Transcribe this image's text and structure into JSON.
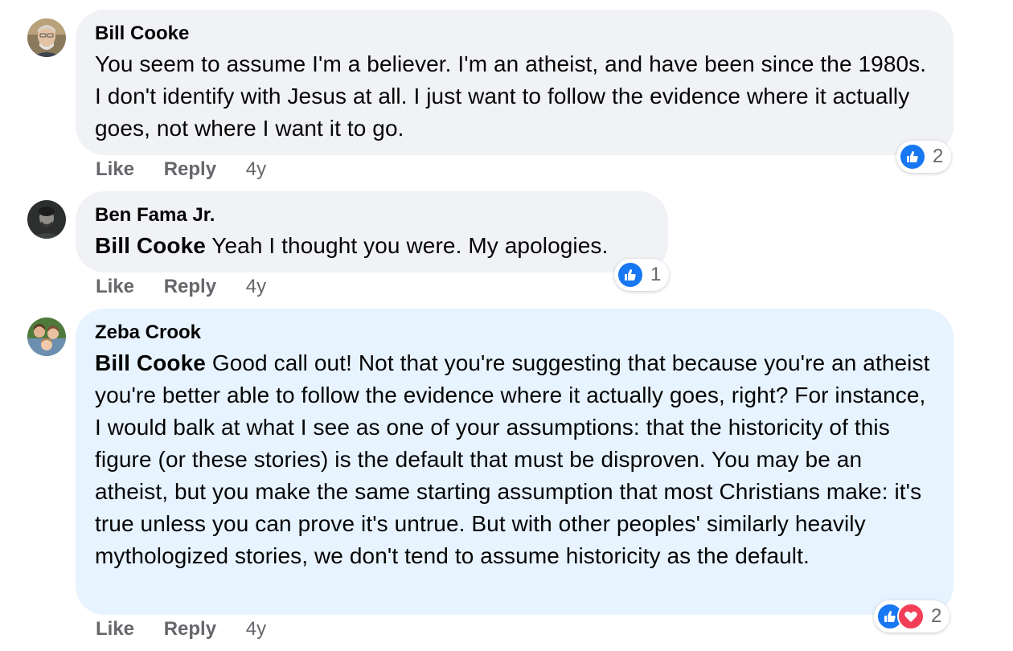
{
  "colors": {
    "bubble_gray": "#f0f2f5",
    "bubble_highlight": "#e7f3ff",
    "meta_text": "#65676b",
    "like_blue": "#1877f2",
    "love_red": "#f33e58"
  },
  "comments": [
    {
      "author": "Bill Cooke",
      "mention": "",
      "text": "You seem to assume I'm a believer. I'm an atheist, and have been since the 1980s. I don't identify with Jesus at all. I just want to follow the evidence where it actually goes, not where I want it to go.",
      "like_label": "Like",
      "reply_label": "Reply",
      "timestamp": "4y",
      "reactions": [
        "like-icon"
      ],
      "reaction_count": "2"
    },
    {
      "author": "Ben Fama Jr.",
      "mention": "Bill Cooke",
      "text": "Yeah I thought you were. My apologies.",
      "like_label": "Like",
      "reply_label": "Reply",
      "timestamp": "4y",
      "reactions": [
        "like-icon"
      ],
      "reaction_count": "1"
    },
    {
      "author": "Zeba Crook",
      "mention": "Bill Cooke",
      "text": "Good call out! Not that you're suggesting that because you're an atheist you're better able to follow the evidence where it actually goes, right? For instance, I would balk at what I see as one of your assumptions: that the historicity of this figure (or these stories) is the default that must be disproven. You may be an atheist, but you make the same starting assumption that most Christians make: it's true unless you can prove it's untrue. But with other peoples' similarly heavily mythologized stories, we don't tend to assume historicity as the default.",
      "like_label": "Like",
      "reply_label": "Reply",
      "timestamp": "4y",
      "reactions": [
        "like-icon",
        "love-icon"
      ],
      "reaction_count": "2"
    }
  ]
}
